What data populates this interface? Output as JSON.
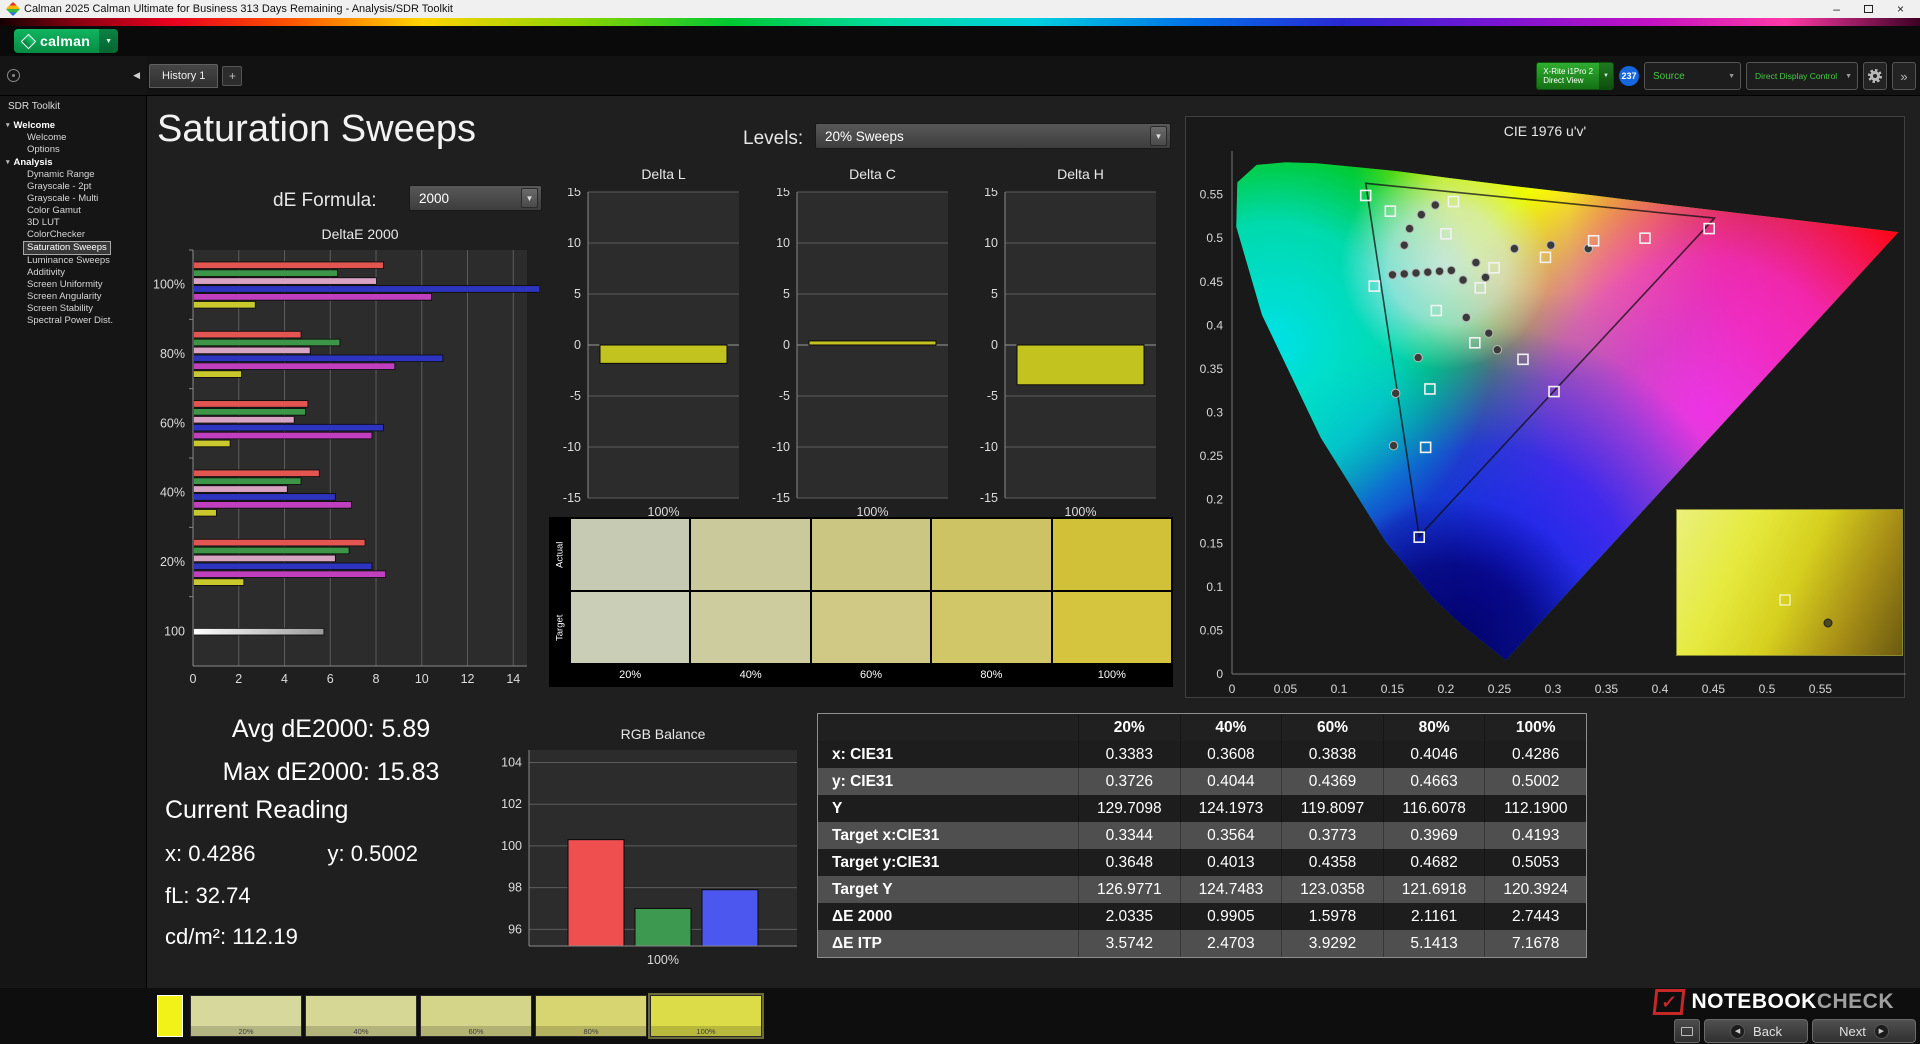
{
  "window": {
    "title": "Calman 2025 Calman Ultimate for Business 313 Days Remaining  - Analysis/SDR Toolkit",
    "controls": {
      "minimize": "–",
      "close": "×"
    }
  },
  "icons": {
    "chevron_down": "▼",
    "tree_expand": "▾",
    "back_arrow": "◀",
    "next_arrow": "▶",
    "collapse_left": "◀",
    "check": "✓",
    "expand": "»"
  },
  "appbar": {
    "logo": "calman"
  },
  "toolbar": {
    "tab": "History 1",
    "add_tab": "+",
    "meter": {
      "line1": "X-Rite i1Pro 2",
      "line2": "Direct View"
    },
    "badge": "237",
    "source": "Source",
    "display_control": "Direct Display Control"
  },
  "sidebar": {
    "header": "SDR Toolkit",
    "selected": "Saturation Sweeps",
    "groups": [
      {
        "label": "Welcome",
        "items": [
          "Welcome",
          "Options"
        ]
      },
      {
        "label": "Analysis",
        "items": [
          "Dynamic Range",
          "Grayscale - 2pt",
          "Grayscale - Multi",
          "Color Gamut",
          "3D LUT",
          "ColorChecker",
          "Saturation Sweeps",
          "Luminance Sweeps",
          "Additivity",
          "Screen Uniformity",
          "Screen Angularity",
          "Screen Stability",
          "Spectral Power Dist."
        ]
      }
    ]
  },
  "main": {
    "title": "Saturation Sweeps",
    "de_formula_label": "dE Formula:",
    "de_formula_value": "2000",
    "levels_label": "Levels:",
    "levels_value": "20% Sweeps",
    "stats": {
      "avg": "Avg dE2000: 5.89",
      "max": "Max dE2000: 15.83",
      "current_heading": "Current Reading",
      "x_value": "x: 0.4286",
      "y_value": "y: 0.5002",
      "fl": "fL: 32.74",
      "cd": "cd/m²: 112.19"
    }
  },
  "chart_data": [
    {
      "id": "delta_e_sweep",
      "type": "bar",
      "orientation": "horizontal",
      "title": "DeltaE 2000",
      "categories": [
        "100%",
        "80%",
        "60%",
        "40%",
        "20%",
        "100"
      ],
      "series": [
        {
          "name": "red",
          "color": "#e25550",
          "values": [
            8.3,
            4.7,
            5.0,
            5.5,
            7.5,
            null
          ]
        },
        {
          "name": "green",
          "color": "#3d9547",
          "values": [
            6.3,
            6.4,
            4.9,
            4.7,
            6.8,
            null
          ]
        },
        {
          "name": "pink",
          "color": "#d9a3c3",
          "values": [
            8.0,
            5.1,
            4.4,
            4.1,
            6.2,
            null
          ]
        },
        {
          "name": "blue",
          "color": "#2d34c0",
          "values": [
            15.8,
            10.9,
            8.3,
            6.2,
            7.8,
            null
          ]
        },
        {
          "name": "magenta",
          "color": "#bf3fbf",
          "values": [
            10.4,
            8.8,
            7.8,
            6.9,
            8.4,
            null
          ]
        },
        {
          "name": "yellow",
          "color": "#c9c92d",
          "values": [
            2.7,
            2.1,
            1.6,
            1.0,
            2.2,
            null
          ]
        },
        {
          "name": "white",
          "color": "#e9e9e9",
          "values": [
            null,
            null,
            null,
            null,
            null,
            5.7
          ]
        }
      ],
      "xlim": [
        0,
        14.6
      ],
      "xticks": [
        0,
        2,
        4,
        6,
        8,
        10,
        12,
        14
      ]
    },
    {
      "id": "delta_l",
      "type": "bar",
      "title": "Delta L",
      "categories": [
        "100%"
      ],
      "values": [
        -1.8
      ],
      "ylim": [
        -15,
        15
      ],
      "yticks": [
        15,
        10,
        5,
        0,
        -5,
        -10,
        -15
      ],
      "bar_color": "#c2c31f"
    },
    {
      "id": "delta_c",
      "type": "bar",
      "title": "Delta C",
      "categories": [
        "100%"
      ],
      "values": [
        0.4
      ],
      "ylim": [
        -15,
        15
      ],
      "yticks": [
        15,
        10,
        5,
        0,
        -5,
        -10,
        -15
      ],
      "bar_color": "#c2c31f"
    },
    {
      "id": "delta_h",
      "type": "bar",
      "title": "Delta H",
      "categories": [
        "100%"
      ],
      "values": [
        -3.9
      ],
      "ylim": [
        -15,
        15
      ],
      "yticks": [
        15,
        10,
        5,
        0,
        -5,
        -10,
        -15
      ],
      "bar_color": "#c2c31f"
    },
    {
      "id": "rgb_balance",
      "type": "bar",
      "title": "RGB Balance",
      "categories": [
        "100%"
      ],
      "series": [
        {
          "name": "Red",
          "color": "#ef4f4f",
          "value": 100.3
        },
        {
          "name": "Green",
          "color": "#3d9950",
          "value": 97.0
        },
        {
          "name": "Blue",
          "color": "#4b57ee",
          "value": 97.9
        }
      ],
      "ylim": [
        95.2,
        104.6
      ],
      "yticks": [
        96,
        98,
        100,
        102,
        104
      ]
    },
    {
      "id": "cie_1976",
      "type": "scatter",
      "title": "CIE 1976 u'v'",
      "xlim": [
        0,
        0.63
      ],
      "ylim": [
        0,
        0.6
      ],
      "xticks": [
        0,
        0.05,
        0.1,
        0.15,
        0.2,
        0.25,
        0.3,
        0.35,
        0.4,
        0.45,
        0.5,
        0.55
      ],
      "yticks": [
        0,
        0.05,
        0.1,
        0.15,
        0.2,
        0.25,
        0.3,
        0.35,
        0.4,
        0.45,
        0.5,
        0.55
      ],
      "locus_uv": [
        [
          0.256,
          0.016
        ],
        [
          0.216,
          0.055
        ],
        [
          0.188,
          0.087
        ],
        [
          0.144,
          0.151
        ],
        [
          0.083,
          0.271
        ],
        [
          0.028,
          0.412
        ],
        [
          0.004,
          0.513
        ],
        [
          0.005,
          0.564
        ],
        [
          0.023,
          0.584
        ],
        [
          0.05,
          0.587
        ],
        [
          0.079,
          0.586
        ],
        [
          0.113,
          0.582
        ],
        [
          0.153,
          0.577
        ],
        [
          0.203,
          0.569
        ],
        [
          0.262,
          0.56
        ],
        [
          0.332,
          0.55
        ],
        [
          0.403,
          0.539
        ],
        [
          0.52,
          0.522
        ],
        [
          0.623,
          0.507
        ]
      ],
      "gamut_triangle_uv": [
        [
          0.451,
          0.523
        ],
        [
          0.125,
          0.563
        ],
        [
          0.175,
          0.158
        ]
      ],
      "target_points_uv": [
        [
          0.125,
          0.549
        ],
        [
          0.148,
          0.531
        ],
        [
          0.207,
          0.542
        ],
        [
          0.2,
          0.505
        ],
        [
          0.133,
          0.445
        ],
        [
          0.245,
          0.466
        ],
        [
          0.293,
          0.478
        ],
        [
          0.338,
          0.497
        ],
        [
          0.386,
          0.5
        ],
        [
          0.446,
          0.511
        ],
        [
          0.232,
          0.443
        ],
        [
          0.191,
          0.417
        ],
        [
          0.227,
          0.38
        ],
        [
          0.272,
          0.361
        ],
        [
          0.185,
          0.327
        ],
        [
          0.301,
          0.324
        ],
        [
          0.181,
          0.26
        ],
        [
          0.175,
          0.157
        ]
      ],
      "measured_points_uv": [
        [
          0.15,
          0.458
        ],
        [
          0.161,
          0.459
        ],
        [
          0.172,
          0.46
        ],
        [
          0.183,
          0.461
        ],
        [
          0.194,
          0.462
        ],
        [
          0.205,
          0.463
        ],
        [
          0.216,
          0.452
        ],
        [
          0.237,
          0.455
        ],
        [
          0.161,
          0.492
        ],
        [
          0.166,
          0.511
        ],
        [
          0.177,
          0.527
        ],
        [
          0.19,
          0.538
        ],
        [
          0.228,
          0.472
        ],
        [
          0.264,
          0.488
        ],
        [
          0.298,
          0.492
        ],
        [
          0.333,
          0.488
        ],
        [
          0.219,
          0.409
        ],
        [
          0.24,
          0.391
        ],
        [
          0.248,
          0.372
        ],
        [
          0.174,
          0.363
        ],
        [
          0.153,
          0.322
        ],
        [
          0.151,
          0.262
        ]
      ],
      "inset": {
        "square": [
          0.48,
          0.62
        ],
        "circle": [
          0.67,
          0.78
        ]
      }
    },
    {
      "id": "saturation_table",
      "type": "table",
      "columns": [
        "20%",
        "40%",
        "60%",
        "80%",
        "100%"
      ],
      "rows": [
        {
          "label": "x: CIE31",
          "values": [
            "0.3383",
            "0.3608",
            "0.3838",
            "0.4046",
            "0.4286"
          ]
        },
        {
          "label": "y: CIE31",
          "values": [
            "0.3726",
            "0.4044",
            "0.4369",
            "0.4663",
            "0.5002"
          ]
        },
        {
          "label": "Y",
          "values": [
            "129.7098",
            "124.1973",
            "119.8097",
            "116.6078",
            "112.1900"
          ]
        },
        {
          "label": "Target x:CIE31",
          "values": [
            "0.3344",
            "0.3564",
            "0.3773",
            "0.3969",
            "0.4193"
          ]
        },
        {
          "label": "Target y:CIE31",
          "values": [
            "0.3648",
            "0.4013",
            "0.4358",
            "0.4682",
            "0.5053"
          ]
        },
        {
          "label": "Target Y",
          "values": [
            "126.9771",
            "124.7483",
            "123.0358",
            "121.6918",
            "120.3924"
          ]
        },
        {
          "label": "ΔE 2000",
          "values": [
            "2.0335",
            "0.9905",
            "1.5978",
            "2.1161",
            "2.7443"
          ]
        },
        {
          "label": "ΔE ITP",
          "values": [
            "3.5742",
            "2.4703",
            "3.9292",
            "5.1413",
            "7.1678"
          ]
        }
      ]
    }
  ],
  "swatch_panel": {
    "row_labels": [
      "Actual",
      "Target"
    ],
    "columns": [
      "20%",
      "40%",
      "60%",
      "80%",
      "100%"
    ],
    "actual_colors": [
      "#c6cab2",
      "#c9c99b",
      "#cbc681",
      "#cec364",
      "#d1c139"
    ],
    "target_colors": [
      "#cbceb6",
      "#cdcc9f",
      "#cfc985",
      "#d2c768",
      "#d5c43d"
    ]
  },
  "bottom": {
    "current_color": "#f2f218",
    "thumbnails": [
      {
        "label": "20%",
        "color": "#d6d89c"
      },
      {
        "label": "40%",
        "color": "#d6d794"
      },
      {
        "label": "60%",
        "color": "#d5d58a"
      },
      {
        "label": "80%",
        "color": "#d7d572"
      },
      {
        "label": "100%",
        "color": "#dcdc49",
        "selected": true
      }
    ],
    "back": "Back",
    "next": "Next"
  },
  "branding": {
    "word1": "NOTEBOOK",
    "word2": "CHECK"
  }
}
